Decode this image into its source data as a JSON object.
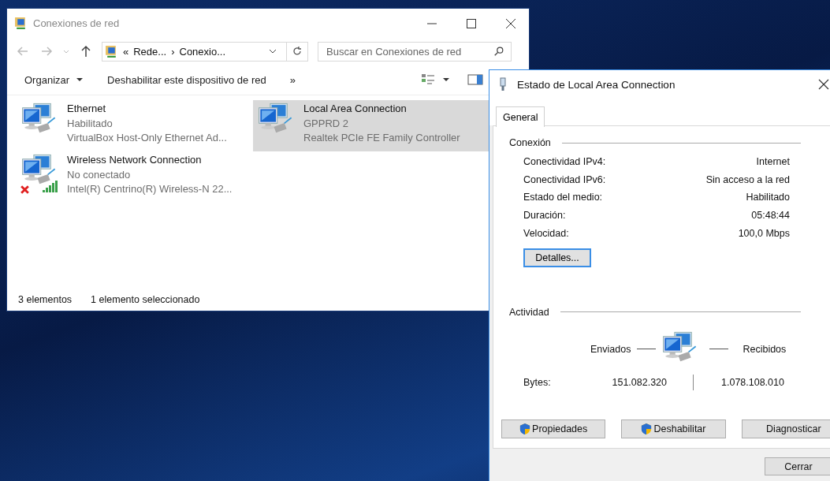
{
  "explorer": {
    "title": "Conexiones de red",
    "breadcrumb": [
      {
        "label": "«"
      },
      {
        "label": "Rede..."
      },
      {
        "label": "›"
      },
      {
        "label": "Conexio..."
      }
    ],
    "search": {
      "placeholder": "Buscar en Conexiones de red"
    },
    "toolbar": [
      {
        "label": "Organizar",
        "dropdown": true
      },
      {
        "label": "Deshabilitar este dispositivo de red",
        "dropdown": false
      },
      {
        "label": "»",
        "dropdown": false
      }
    ],
    "connections": [
      {
        "name": "Ethernet",
        "status": "Habilitado",
        "device": "VirtualBox Host-Only Ethernet Ad...",
        "kind": "wired",
        "disconnected": false,
        "selected": false
      },
      {
        "name": "Local Area Connection",
        "status": "GPPRD  2",
        "device": "Realtek PCIe FE Family Controller",
        "kind": "wired",
        "disconnected": false,
        "selected": true
      },
      {
        "name": "Wireless Network Connection",
        "status": "No conectado",
        "device": "Intel(R) Centrino(R) Wireless-N 22...",
        "kind": "wireless",
        "disconnected": true,
        "selected": false
      }
    ],
    "status_bar": [
      "3 elementos",
      "1 elemento seleccionado"
    ]
  },
  "dialog": {
    "title": "Estado de Local Area Connection",
    "tabs": [
      {
        "label": "General",
        "selected": true
      }
    ],
    "connection": {
      "heading": "Conexión",
      "rows": [
        {
          "label": "Conectividad IPv4:",
          "value": "Internet"
        },
        {
          "label": "Conectividad IPv6:",
          "value": "Sin acceso a la red"
        },
        {
          "label": "Estado del medio:",
          "value": "Habilitado"
        },
        {
          "label": "Duración:",
          "value": "05:48:44"
        },
        {
          "label": "Velocidad:",
          "value": "100,0 Mbps"
        }
      ],
      "details_button": "Detalles..."
    },
    "activity": {
      "heading": "Actividad",
      "sent_label": "Enviados",
      "received_label": "Recibidos",
      "bytes_label": "Bytes:",
      "sent": "151.082.320",
      "received": "1.078.108.010"
    },
    "buttons": [
      {
        "label": "Propiedades",
        "kind": "shield"
      },
      {
        "label": "Deshabilitar",
        "kind": "shield"
      },
      {
        "label": "Diagnosticar",
        "kind": "plain"
      }
    ],
    "close_button": "Cerrar"
  }
}
